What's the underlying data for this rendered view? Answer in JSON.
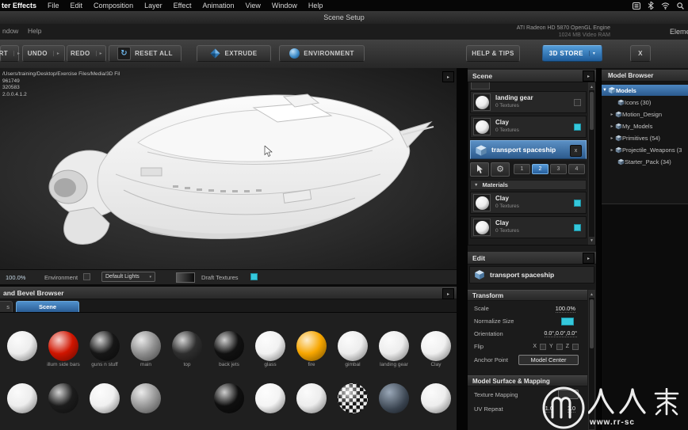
{
  "icons": {
    "expand": "▸",
    "collapse": "▼",
    "dropdown": "▾",
    "up": "▲",
    "down": "▼",
    "reset": "↻",
    "gear": "⚙"
  },
  "menubar": {
    "items": [
      "ter Effects",
      "File",
      "Edit",
      "Composition",
      "Layer",
      "Effect",
      "Animation",
      "View",
      "Window",
      "Help"
    ]
  },
  "titlebar": {
    "title": "Scene Setup"
  },
  "infobar": {
    "window_menu": "ndow",
    "help_menu": "Help",
    "gpu_line1": "ATI Radeon HD 5870 OpenGL Engine",
    "gpu_line2": "1024 MB Video RAM",
    "panel_partial": "Element"
  },
  "toolbar": {
    "import_partial": "RT",
    "undo": "UNDO",
    "redo": "REDO",
    "reset_all": "RESET ALL",
    "extrude": "EXTRUDE",
    "environment": "ENVIRONMENT",
    "help_tips": "HELP & TIPS",
    "store": "3D STORE",
    "close": "X"
  },
  "viewport": {
    "info_lines": [
      "/Users/training/Desktop/Exercise Files/Media/3D Fil",
      "961749",
      "320583",
      "2.0.0.4.1.2"
    ],
    "zoom": "100.0%",
    "environment_label": "Environment",
    "lights_value": "Default Lights",
    "draft_label": "Draft Textures"
  },
  "bevel_browser": {
    "title": "and Bevel Browser",
    "tab_partial": "s",
    "tab_scene": "Scene",
    "row1": [
      {
        "label": "",
        "color": "#ededed"
      },
      {
        "label": "illum side bars",
        "color": "#d01500"
      },
      {
        "label": "guns n stuff",
        "color": "#161616"
      },
      {
        "label": "main",
        "color": "#8f8f8f"
      },
      {
        "label": "top",
        "color": "#2e2e2e"
      },
      {
        "label": "back jets",
        "color": "#111111"
      },
      {
        "label": "glass",
        "color": "#f2f2f2"
      },
      {
        "label": "fire",
        "color": "#f7a600"
      },
      {
        "label": "gimbal",
        "color": "#ededed"
      },
      {
        "label": "landing gear",
        "color": "#ededed"
      },
      {
        "label": "Clay",
        "color": "#f0f0f0"
      }
    ],
    "row2": [
      {
        "label": "",
        "color": "#ededed"
      },
      {
        "label": "",
        "color": "#1c1c1c"
      },
      {
        "label": "",
        "color": "#f0f0f0"
      },
      {
        "label": "",
        "color": "#9a9a9a"
      },
      {
        "label": "",
        "color": "#e6e6e6"
      },
      {
        "label": "",
        "color": "#0f0f0f"
      },
      {
        "label": "",
        "color": "#f4f4f4"
      },
      {
        "label": "",
        "color": "#ededed"
      },
      {
        "label": "",
        "color": "checker"
      },
      {
        "label": "",
        "color": "env"
      },
      {
        "label": "",
        "color": "#ededed"
      }
    ]
  },
  "scene_panel": {
    "title": "Scene",
    "items": [
      {
        "name": "landing gear",
        "sub": "0 Textures",
        "thumb": "#ececec",
        "checked": false
      },
      {
        "name": "Clay",
        "sub": "0 Textures",
        "thumb": "#ececec",
        "checked": true
      }
    ],
    "selected_item": "transport spaceship",
    "close_glyph": "x",
    "group_buttons": [
      "1",
      "2",
      "3",
      "4"
    ],
    "active_group": "2",
    "materials_header": "Materials",
    "materials": [
      {
        "name": "Clay",
        "sub": "0 Textures",
        "thumb": "#ececec",
        "checked": true
      },
      {
        "name": "Clay",
        "sub": "0 Textures",
        "thumb": "#ececec",
        "checked": true
      }
    ]
  },
  "edit_panel": {
    "title": "Edit",
    "model_name": "transport spaceship",
    "transform_header": "Transform",
    "scale_label": "Scale",
    "scale_value": "100.0%",
    "normalize_label": "Normalize Size",
    "orientation_label": "Orientation",
    "orientation_value": "0.0°,0.0°,0.0°",
    "flip_label": "Flip",
    "flip_axes": [
      "X",
      "Y",
      "Z"
    ],
    "anchor_label": "Anchor Point",
    "anchor_value": "Model Center",
    "surface_header": "Model Surface & Mapping",
    "texture_mapping_label": "Texture Mapping",
    "uv_repeat_label": "UV Repeat",
    "uv_repeat_x": "1.0",
    "uv_repeat_y": "1.0"
  },
  "model_browser": {
    "title": "Model Browser",
    "tree": [
      {
        "label": "Models",
        "selected": true,
        "expanded": true
      },
      {
        "label": "Icons (30)"
      },
      {
        "label": "Motion_Design",
        "arrow": true
      },
      {
        "label": "My_Models",
        "arrow": true
      },
      {
        "label": "Primitives (54)",
        "arrow": true
      },
      {
        "label": "Projectile_Weapons (3",
        "arrow": true
      },
      {
        "label": "Starter_Pack (34)"
      }
    ]
  },
  "watermark": {
    "brand": "人人素",
    "url": "www.rr-sc"
  },
  "colors": {
    "selection_blue": "#3f7ab8",
    "teal_checkbox": "#35c8dc",
    "store_button_blue": "#2f7cc0"
  }
}
